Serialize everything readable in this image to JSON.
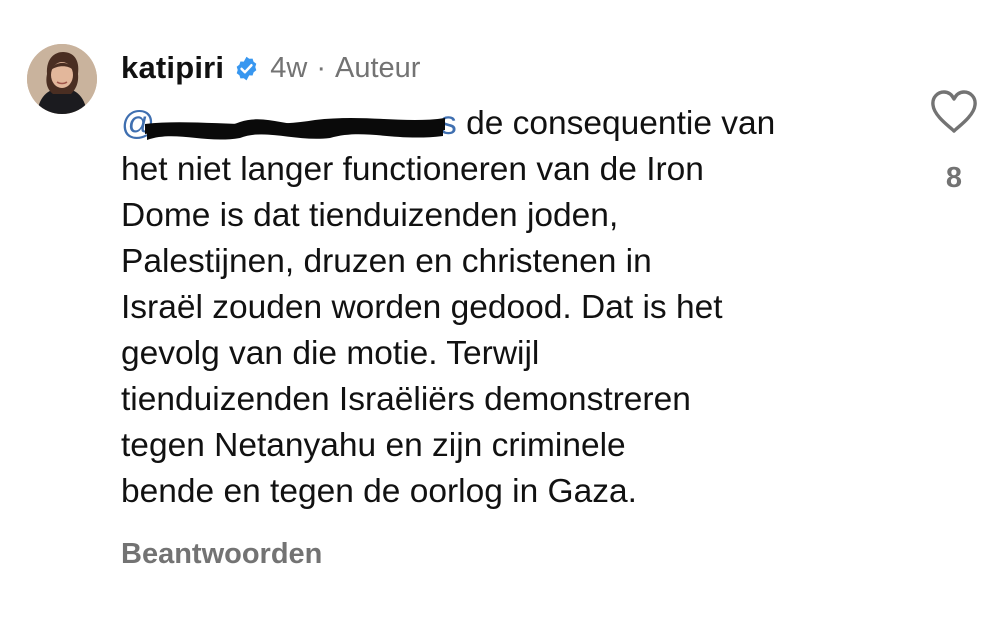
{
  "comment": {
    "username": "katipiri",
    "verified": true,
    "verified_color": "#3897f0",
    "time_ago": "4w",
    "separator": "·",
    "role": "Auteur",
    "mention_partial_visible": "@",
    "mention_tail_visible": "s",
    "mention_color": "#3f6fb0",
    "lines": [
      "de consequentie van",
      "het niet langer functioneren van de Iron",
      "Dome is dat tienduizenden joden,",
      "Palestijnen, druzen en christenen in",
      "Israël zouden worden gedood. Dat is het",
      "gevolg van die motie. Terwijl",
      "tienduizenden Israëliërs demonstreren",
      "tegen Netanyahu en zijn criminele",
      "bende en tegen de oorlog in Gaza."
    ],
    "reply_label": "Beantwoorden"
  },
  "likes": {
    "icon": "heart-outline-icon",
    "count": "8"
  },
  "colors": {
    "text_primary": "#111111",
    "text_secondary": "#737373",
    "background": "#ffffff"
  }
}
